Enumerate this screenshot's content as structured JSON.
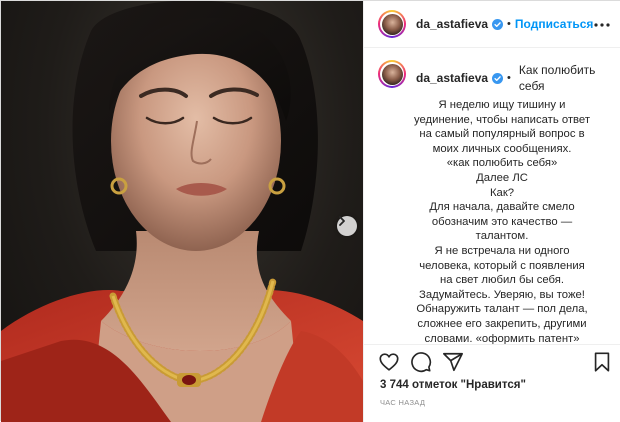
{
  "post": {
    "photo_alt": "",
    "carousel_next_icon": "chevron-right-icon"
  },
  "header": {
    "username": "da_astafieva",
    "verified_icon": "verified-badge-icon",
    "separator": "•",
    "follow_label": "Подписаться",
    "more_icon": "more-horizontal-icon"
  },
  "caption": {
    "username": "da_astafieva",
    "separator": "•",
    "title": "Как полюбить себя",
    "body": "Я неделю ищу тишину и уединение, чтобы написать ответ на самый популярный вопрос в моих личных сообщениях.\n«как полюбить себя»\nДалее ЛС\nКак?\nДля начала, давайте смело обозначим это качество — талантом.\nЯ не встречала ни одного человека, который с появления на свет любил бы себя. Задумайтесь. Уверяю, вы тоже!\nОбнаружить талант — пол дела, сложнее его закрепить, другими словами. «оформить патент»\nКаааааак? Зачастую пишете вы"
  },
  "actions": {
    "like_icon": "heart-icon",
    "comment_icon": "comment-icon",
    "share_icon": "share-icon",
    "save_icon": "bookmark-icon"
  },
  "likes_text": "3 744 отметок \"Нравится\"",
  "time_text": "час назад",
  "colors": {
    "link_blue": "#0095f6",
    "border": "#dbdbdb",
    "text": "#262626",
    "muted": "#8e8e8e"
  }
}
